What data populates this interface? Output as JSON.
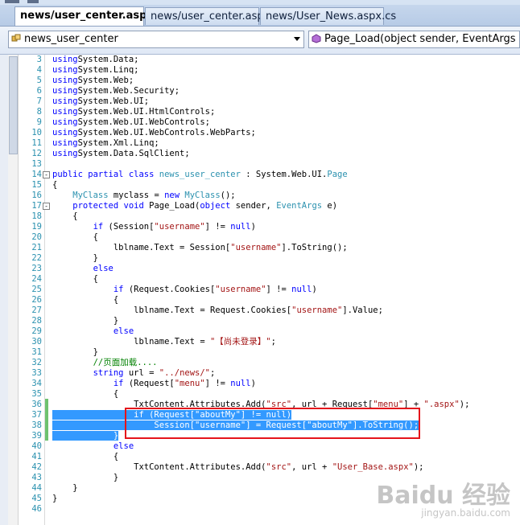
{
  "tabs": [
    {
      "label": "news/user_center.aspx.cs",
      "active": true
    },
    {
      "label": "news/user_center.aspx",
      "active": false
    },
    {
      "label": "news/User_News.aspx.cs",
      "active": false
    }
  ],
  "class_dropdown": {
    "value": "news_user_center"
  },
  "member_dropdown": {
    "value": "Page_Load(object sender, EventArgs e)"
  },
  "colors": {
    "keyword": "#0000ff",
    "type": "#2b91af",
    "string": "#a31515",
    "comment": "#008000",
    "selection": "#3399ff",
    "callout": "#e5141b"
  },
  "code_lines": [
    {
      "n": "3",
      "segs": [
        [
          "kw",
          "using"
        ],
        [
          "",
          "System.Data;"
        ]
      ]
    },
    {
      "n": "4",
      "segs": [
        [
          "kw",
          "using"
        ],
        [
          "",
          "System.Linq;"
        ]
      ]
    },
    {
      "n": "5",
      "segs": [
        [
          "kw",
          "using"
        ],
        [
          "",
          "System.Web;"
        ]
      ]
    },
    {
      "n": "6",
      "segs": [
        [
          "kw",
          "using"
        ],
        [
          "",
          "System.Web.Security;"
        ]
      ]
    },
    {
      "n": "7",
      "segs": [
        [
          "kw",
          "using"
        ],
        [
          "",
          "System.Web.UI;"
        ]
      ]
    },
    {
      "n": "8",
      "segs": [
        [
          "kw",
          "using"
        ],
        [
          "",
          "System.Web.UI.HtmlControls;"
        ]
      ]
    },
    {
      "n": "9",
      "segs": [
        [
          "kw",
          "using"
        ],
        [
          "",
          "System.Web.UI.WebControls;"
        ]
      ]
    },
    {
      "n": "10",
      "segs": [
        [
          "kw",
          "using"
        ],
        [
          "",
          "System.Web.UI.WebControls.WebParts;"
        ]
      ]
    },
    {
      "n": "11",
      "segs": [
        [
          "kw",
          "using"
        ],
        [
          "",
          "System.Xml.Linq;"
        ]
      ]
    },
    {
      "n": "12",
      "segs": [
        [
          "kw",
          "using"
        ],
        [
          "",
          "System.Data.SqlClient;"
        ]
      ]
    },
    {
      "n": "13",
      "segs": []
    },
    {
      "n": "14",
      "segs": [
        [
          "kw",
          "public partial class"
        ],
        [
          "ty",
          " news_user_center"
        ],
        [
          "",
          " : System.Web.UI."
        ],
        [
          "ty",
          "Page"
        ]
      ],
      "fold": "-"
    },
    {
      "n": "15",
      "segs": [
        [
          "",
          "{"
        ]
      ]
    },
    {
      "n": "16",
      "segs": [
        [
          "ty",
          "    MyClass"
        ],
        [
          "",
          " myclass = "
        ],
        [
          "kw",
          "new"
        ],
        [
          "ty",
          " MyClass"
        ],
        [
          "",
          "();"
        ]
      ]
    },
    {
      "n": "17",
      "segs": [
        [
          "kw",
          "    protected void"
        ],
        [
          "",
          " Page_Load("
        ],
        [
          "kw",
          "object"
        ],
        [
          "",
          " sender, "
        ],
        [
          "ty",
          "EventArgs"
        ],
        [
          "",
          " e)"
        ]
      ],
      "fold": "-"
    },
    {
      "n": "18",
      "segs": [
        [
          "",
          "    {"
        ]
      ]
    },
    {
      "n": "19",
      "segs": [
        [
          "kw",
          "        if"
        ],
        [
          "",
          " (Session["
        ],
        [
          "st",
          "\"username\""
        ],
        [
          "",
          "] != "
        ],
        [
          "kw",
          "null"
        ],
        [
          "",
          ")"
        ]
      ]
    },
    {
      "n": "20",
      "segs": [
        [
          "",
          "        {"
        ]
      ]
    },
    {
      "n": "21",
      "segs": [
        [
          "",
          "            lblname.Text = Session["
        ],
        [
          "st",
          "\"username\""
        ],
        [
          "",
          "].ToString();"
        ]
      ]
    },
    {
      "n": "22",
      "segs": [
        [
          "",
          "        }"
        ]
      ]
    },
    {
      "n": "23",
      "segs": [
        [
          "kw",
          "        else"
        ]
      ]
    },
    {
      "n": "24",
      "segs": [
        [
          "",
          "        {"
        ]
      ]
    },
    {
      "n": "25",
      "segs": [
        [
          "kw",
          "            if"
        ],
        [
          "",
          " (Request.Cookies["
        ],
        [
          "st",
          "\"username\""
        ],
        [
          "",
          "] != "
        ],
        [
          "kw",
          "null"
        ],
        [
          "",
          ")"
        ]
      ]
    },
    {
      "n": "26",
      "segs": [
        [
          "",
          "            {"
        ]
      ]
    },
    {
      "n": "27",
      "segs": [
        [
          "",
          "                lblname.Text = Request.Cookies["
        ],
        [
          "st",
          "\"username\""
        ],
        [
          "",
          "].Value;"
        ]
      ]
    },
    {
      "n": "28",
      "segs": [
        [
          "",
          "            }"
        ]
      ]
    },
    {
      "n": "29",
      "segs": [
        [
          "kw",
          "            else"
        ]
      ]
    },
    {
      "n": "30",
      "segs": [
        [
          "",
          "                lblname.Text = "
        ],
        [
          "st",
          "\"【尚未登录】\""
        ],
        [
          "",
          ";"
        ]
      ]
    },
    {
      "n": "31",
      "segs": [
        [
          "",
          "        }"
        ]
      ]
    },
    {
      "n": "32",
      "segs": [
        [
          "cm",
          "        //页面加载...."
        ]
      ]
    },
    {
      "n": "33",
      "segs": [
        [
          "kw",
          "        string"
        ],
        [
          "",
          " url = "
        ],
        [
          "st",
          "\"../news/\""
        ],
        [
          "",
          ";"
        ]
      ]
    },
    {
      "n": "34",
      "segs": [
        [
          "kw",
          "            if"
        ],
        [
          "",
          " (Request["
        ],
        [
          "st",
          "\"menu\""
        ],
        [
          "",
          "] != "
        ],
        [
          "kw",
          "null"
        ],
        [
          "",
          ")"
        ]
      ]
    },
    {
      "n": "35",
      "segs": [
        [
          "",
          "            {"
        ]
      ]
    },
    {
      "n": "36",
      "segs": [
        [
          "",
          "                TxtContent.Attributes.Add("
        ],
        [
          "st",
          "\"src\""
        ],
        [
          "",
          ", url + Request["
        ],
        [
          "st",
          "\"menu\""
        ],
        [
          "",
          "] + "
        ],
        [
          "st",
          "\".aspx\""
        ],
        [
          "",
          ");"
        ]
      ]
    },
    {
      "n": "37",
      "segs": [
        [
          "hl",
          "                if (Request[\"aboutMy\"] != null)"
        ]
      ]
    },
    {
      "n": "38",
      "segs": [
        [
          "hl",
          "                    Session[\"username\"] = Request[\"aboutMy\"].ToString();"
        ]
      ]
    },
    {
      "n": "39",
      "segs": [
        [
          "hl",
          "            }"
        ]
      ]
    },
    {
      "n": "40",
      "segs": [
        [
          "kw",
          "            else"
        ]
      ]
    },
    {
      "n": "41",
      "segs": [
        [
          "",
          "            {"
        ]
      ]
    },
    {
      "n": "42",
      "segs": [
        [
          "",
          "                TxtContent.Attributes.Add("
        ],
        [
          "st",
          "\"src\""
        ],
        [
          "",
          ", url + "
        ],
        [
          "st",
          "\"User_Base.aspx\""
        ],
        [
          "",
          ");"
        ]
      ]
    },
    {
      "n": "43",
      "segs": [
        [
          "",
          "            }"
        ]
      ]
    },
    {
      "n": "44",
      "segs": [
        [
          "",
          "    }"
        ]
      ]
    },
    {
      "n": "45",
      "segs": [
        [
          "",
          "}"
        ]
      ]
    },
    {
      "n": "46",
      "segs": []
    }
  ],
  "watermark": {
    "logo_text": "Baidu 经验",
    "url": "jingyan.baidu.com"
  }
}
